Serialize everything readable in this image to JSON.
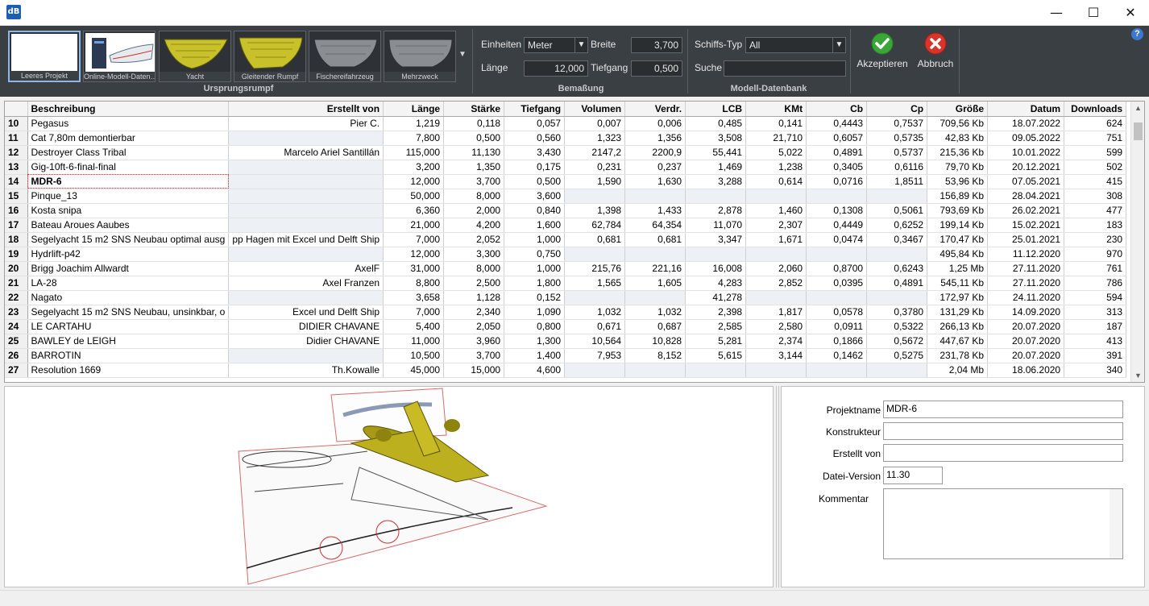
{
  "window": {
    "logo_text": "dB",
    "minimize_glyph": "—",
    "maximize_glyph": "☐",
    "close_glyph": "✕"
  },
  "ribbon": {
    "hull_group": {
      "caption": "Ursprungsrumpf",
      "thumbnails": [
        {
          "label": "Leeres Projekt"
        },
        {
          "label": "Online-Modell-Daten…"
        },
        {
          "label": "Yacht"
        },
        {
          "label": "Gleitender Rumpf"
        },
        {
          "label": "Fischereifahrzeug"
        },
        {
          "label": "Mehrzweck"
        }
      ]
    },
    "dimension_group": {
      "caption": "Bemaßung",
      "units_label": "Einheiten",
      "units_value": "Meter",
      "width_label": "Breite",
      "width_value": "3,700",
      "length_label": "Länge",
      "length_value": "12,000",
      "draft_label": "Tiefgang",
      "draft_value": "0,500"
    },
    "db_group": {
      "caption": "Modell-Datenbank",
      "ship_type_label": "Schiffs-Typ",
      "ship_type_value": "All",
      "search_label": "Suche",
      "search_value": ""
    },
    "accept_label": "Akzeptieren",
    "cancel_label": "Abbruch",
    "help_glyph": "?"
  },
  "table": {
    "columns": [
      "",
      "Beschreibung",
      "Erstellt von",
      "Länge",
      "Stärke",
      "Tiefgang",
      "Volumen",
      "Verdr.",
      "LCB",
      "KMt",
      "Cb",
      "Cp",
      "Größe",
      "Datum",
      "Downloads"
    ],
    "rows": [
      [
        "10",
        "Pegasus",
        "Pier C.",
        "1,219",
        "0,118",
        "0,057",
        "0,007",
        "0,006",
        "0,485",
        "0,141",
        "0,4443",
        "0,7537",
        "709,56 Kb",
        "18.07.2022",
        "624"
      ],
      [
        "11",
        "Cat 7,80m demontierbar",
        "",
        "7,800",
        "0,500",
        "0,560",
        "1,323",
        "1,356",
        "3,508",
        "21,710",
        "0,6057",
        "0,5735",
        "42,83 Kb",
        "09.05.2022",
        "751"
      ],
      [
        "12",
        "Destroyer Class Tribal",
        "Marcelo Ariel Santillán",
        "115,000",
        "11,130",
        "3,430",
        "2147,2",
        "2200,9",
        "55,441",
        "5,022",
        "0,4891",
        "0,5737",
        "215,36 Kb",
        "10.01.2022",
        "599"
      ],
      [
        "13",
        "Gig-10ft-6-final-final",
        "",
        "3,200",
        "1,350",
        "0,175",
        "0,231",
        "0,237",
        "1,469",
        "1,238",
        "0,3405",
        "0,6116",
        "79,70 Kb",
        "20.12.2021",
        "502"
      ],
      [
        "14",
        "MDR-6",
        "",
        "12,000",
        "3,700",
        "0,500",
        "1,590",
        "1,630",
        "3,288",
        "0,614",
        "0,0716",
        "1,8511",
        "53,96 Kb",
        "07.05.2021",
        "415"
      ],
      [
        "15",
        "Pinque_13",
        "",
        "50,000",
        "8,000",
        "3,600",
        "",
        "",
        "",
        "",
        "",
        "",
        "156,89 Kb",
        "28.04.2021",
        "308"
      ],
      [
        "16",
        "Kosta snipa",
        "",
        "6,360",
        "2,000",
        "0,840",
        "1,398",
        "1,433",
        "2,878",
        "1,460",
        "0,1308",
        "0,5061",
        "793,69 Kb",
        "26.02.2021",
        "477"
      ],
      [
        "17",
        "Bateau Aroues Aaubes",
        "",
        "21,000",
        "4,200",
        "1,600",
        "62,784",
        "64,354",
        "11,070",
        "2,307",
        "0,4449",
        "0,6252",
        "199,14 Kb",
        "15.02.2021",
        "183"
      ],
      [
        "18",
        "Segelyacht 15 m2 SNS Neubau optimal ausg",
        "pp Hagen mit Excel und Delft Ship",
        "7,000",
        "2,052",
        "1,000",
        "0,681",
        "0,681",
        "3,347",
        "1,671",
        "0,0474",
        "0,3467",
        "170,47 Kb",
        "25.01.2021",
        "230"
      ],
      [
        "19",
        "Hydrlift-p42",
        "",
        "12,000",
        "3,300",
        "0,750",
        "",
        "",
        "",
        "",
        "",
        "",
        "495,84 Kb",
        "11.12.2020",
        "970"
      ],
      [
        "20",
        "Brigg Joachim Allwardt",
        "AxelF",
        "31,000",
        "8,000",
        "1,000",
        "215,76",
        "221,16",
        "16,008",
        "2,060",
        "0,8700",
        "0,6243",
        "1,25 Mb",
        "27.11.2020",
        "761"
      ],
      [
        "21",
        "LA-28",
        "Axel Franzen",
        "8,800",
        "2,500",
        "1,800",
        "1,565",
        "1,605",
        "4,283",
        "2,852",
        "0,0395",
        "0,4891",
        "545,11 Kb",
        "27.11.2020",
        "786"
      ],
      [
        "22",
        "Nagato",
        "",
        "3,658",
        "1,128",
        "0,152",
        "",
        "",
        "41,278",
        "",
        "",
        "",
        "172,97 Kb",
        "24.11.2020",
        "594"
      ],
      [
        "23",
        "Segelyacht 15 m2 SNS Neubau, unsinkbar, o",
        "Excel und Delft Ship",
        "7,000",
        "2,340",
        "1,090",
        "1,032",
        "1,032",
        "2,398",
        "1,817",
        "0,0578",
        "0,3780",
        "131,29 Kb",
        "14.09.2020",
        "313"
      ],
      [
        "24",
        "LE CARTAHU",
        "DIDIER CHAVANE",
        "5,400",
        "2,050",
        "0,800",
        "0,671",
        "0,687",
        "2,585",
        "2,580",
        "0,0911",
        "0,5322",
        "266,13 Kb",
        "20.07.2020",
        "187"
      ],
      [
        "25",
        "BAWLEY de LEIGH",
        "Didier CHAVANE",
        "11,000",
        "3,960",
        "1,300",
        "10,564",
        "10,828",
        "5,281",
        "2,374",
        "0,1866",
        "0,5672",
        "447,67 Kb",
        "20.07.2020",
        "413"
      ],
      [
        "26",
        "BARROTIN",
        "",
        "10,500",
        "3,700",
        "1,400",
        "7,953",
        "8,152",
        "5,615",
        "3,144",
        "0,1462",
        "0,5275",
        "231,78 Kb",
        "20.07.2020",
        "391"
      ],
      [
        "27",
        "Resolution 1669",
        "Th.Kowalle",
        "45,000",
        "15,000",
        "4,600",
        "",
        "",
        "",
        "",
        "",
        "",
        "2,04 Mb",
        "18.06.2020",
        "340"
      ]
    ],
    "current_row_index": 4
  },
  "properties": {
    "project_name_label": "Projektname",
    "project_name_value": "MDR-6",
    "designer_label": "Konstrukteur",
    "designer_value": "",
    "created_by_label": "Erstellt von",
    "created_by_value": "",
    "file_version_label": "Datei-Version",
    "file_version_value": "11.30",
    "comment_label": "Kommentar",
    "comment_value": ""
  },
  "colors": {
    "ribbon_bg": "#3a3f43",
    "accept_green": "#3aa637",
    "cancel_red": "#d9342b",
    "hull_yellow": "#c9c12a",
    "plane_olive": "#a89a14"
  }
}
